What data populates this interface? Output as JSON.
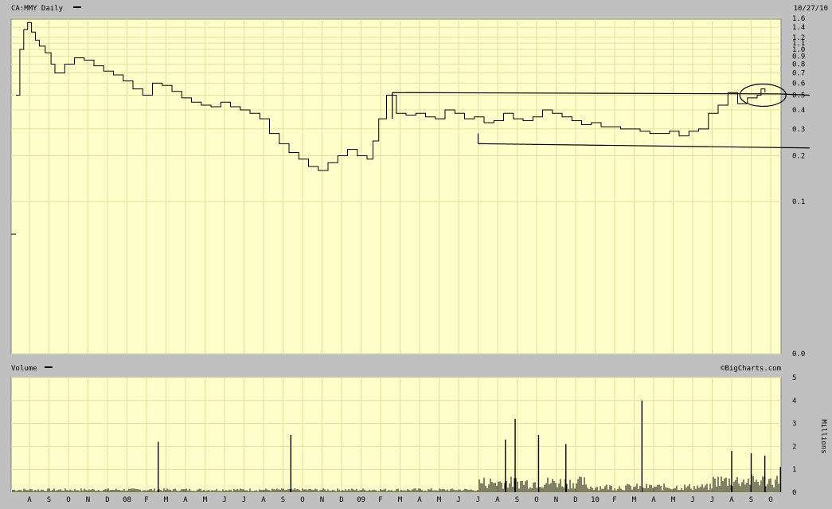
{
  "header": {
    "title": "CA:MMY Daily",
    "date": "10/27/10"
  },
  "volume_panel": {
    "title": "Volume",
    "credit": "©BigCharts.com",
    "unit_label": "Millions"
  },
  "colors": {
    "panel_background": "#ffffcc",
    "grid": "#e0e0a0",
    "frame": "#c0c0c0",
    "line": "#000000"
  },
  "chart_data": [
    {
      "type": "line",
      "title": "CA:MMY Daily",
      "scale": "log",
      "ylim": [
        0.0,
        1.6
      ],
      "y_ticks": [
        "1.6",
        "1.4",
        "1.2",
        "1.1",
        "1.0",
        "0.9",
        "0.8",
        "0.7",
        "0.6",
        "0.5",
        "0.4",
        "0.3",
        "0.2",
        "0.1",
        "0.0"
      ],
      "x_ticks": [
        "A",
        "S",
        "O",
        "N",
        "D",
        "08",
        "F",
        "M",
        "A",
        "M",
        "J",
        "J",
        "A",
        "S",
        "O",
        "N",
        "D",
        "09",
        "F",
        "M",
        "A",
        "M",
        "J",
        "J",
        "A",
        "S",
        "O",
        "N",
        "D",
        "10",
        "F",
        "M",
        "A",
        "M",
        "J",
        "J",
        "A",
        "S",
        "O"
      ],
      "grid": true,
      "series": [
        {
          "x": [
            0,
            0.2,
            0.4,
            0.6,
            0.8,
            1,
            1.2,
            1.5,
            1.8,
            2,
            2.5,
            3,
            3.5,
            4,
            4.5,
            5,
            5.5,
            6,
            6.5,
            7,
            7.5,
            8,
            8.5,
            9,
            9.5,
            10,
            10.5,
            11,
            11.5,
            12,
            12.5,
            13,
            13.5,
            14,
            14.5,
            15,
            15.5,
            16,
            16.5,
            17,
            17.5,
            18,
            18.3,
            18.6,
            19,
            19.5,
            20,
            20.5,
            21,
            21.5,
            22,
            22.5,
            23,
            23.5,
            24,
            24.5,
            25,
            25.5,
            26,
            26.5,
            27,
            27.5,
            28,
            28.5,
            29,
            29.5,
            30,
            30.5,
            31,
            31.5,
            32,
            32.5,
            33,
            33.5,
            34,
            34.5,
            35,
            35.5,
            36,
            36.5,
            37,
            37.5,
            38,
            38.2,
            38.4
          ],
          "y": [
            0.5,
            1.0,
            1.35,
            1.5,
            1.3,
            1.15,
            1.05,
            0.95,
            0.8,
            0.7,
            0.8,
            0.88,
            0.85,
            0.78,
            0.72,
            0.68,
            0.62,
            0.55,
            0.5,
            0.6,
            0.58,
            0.53,
            0.48,
            0.45,
            0.43,
            0.42,
            0.45,
            0.42,
            0.4,
            0.38,
            0.35,
            0.28,
            0.24,
            0.21,
            0.19,
            0.17,
            0.16,
            0.18,
            0.2,
            0.22,
            0.2,
            0.19,
            0.25,
            0.35,
            0.5,
            0.38,
            0.37,
            0.38,
            0.36,
            0.35,
            0.4,
            0.38,
            0.35,
            0.36,
            0.33,
            0.34,
            0.38,
            0.35,
            0.34,
            0.36,
            0.4,
            0.38,
            0.36,
            0.34,
            0.32,
            0.33,
            0.31,
            0.31,
            0.3,
            0.3,
            0.29,
            0.28,
            0.28,
            0.29,
            0.27,
            0.29,
            0.3,
            0.38,
            0.43,
            0.52,
            0.44,
            0.48,
            0.5,
            0.55,
            0.52
          ]
        }
      ],
      "annotations": {
        "upper_line": {
          "x": [
            18.6,
            38.4
          ],
          "y": [
            0.52,
            0.51
          ],
          "x2": 40.0,
          "y2": 0.5
        },
        "lower_line": {
          "x": [
            23.0,
            40.0
          ],
          "y": [
            0.24,
            0.225
          ]
        },
        "ellipse": {
          "cx": 37.6,
          "cy": 0.5
        }
      }
    },
    {
      "type": "bar",
      "title": "Volume",
      "ylabel": "Millions",
      "ylim": [
        0,
        5
      ],
      "y_ticks": [
        "5",
        "4",
        "3",
        "2",
        "1",
        "0"
      ],
      "grid": true,
      "spikes": [
        {
          "x": 6.6,
          "v": 2.2
        },
        {
          "x": 13.4,
          "v": 2.5
        },
        {
          "x": 24.4,
          "v": 2.3
        },
        {
          "x": 24.9,
          "v": 3.2
        },
        {
          "x": 26.1,
          "v": 2.5
        },
        {
          "x": 27.5,
          "v": 2.1
        },
        {
          "x": 31.4,
          "v": 4.0
        },
        {
          "x": 36.0,
          "v": 1.8
        },
        {
          "x": 37.0,
          "v": 1.7
        },
        {
          "x": 37.7,
          "v": 1.6
        },
        {
          "x": 38.5,
          "v": 1.1
        }
      ]
    }
  ]
}
